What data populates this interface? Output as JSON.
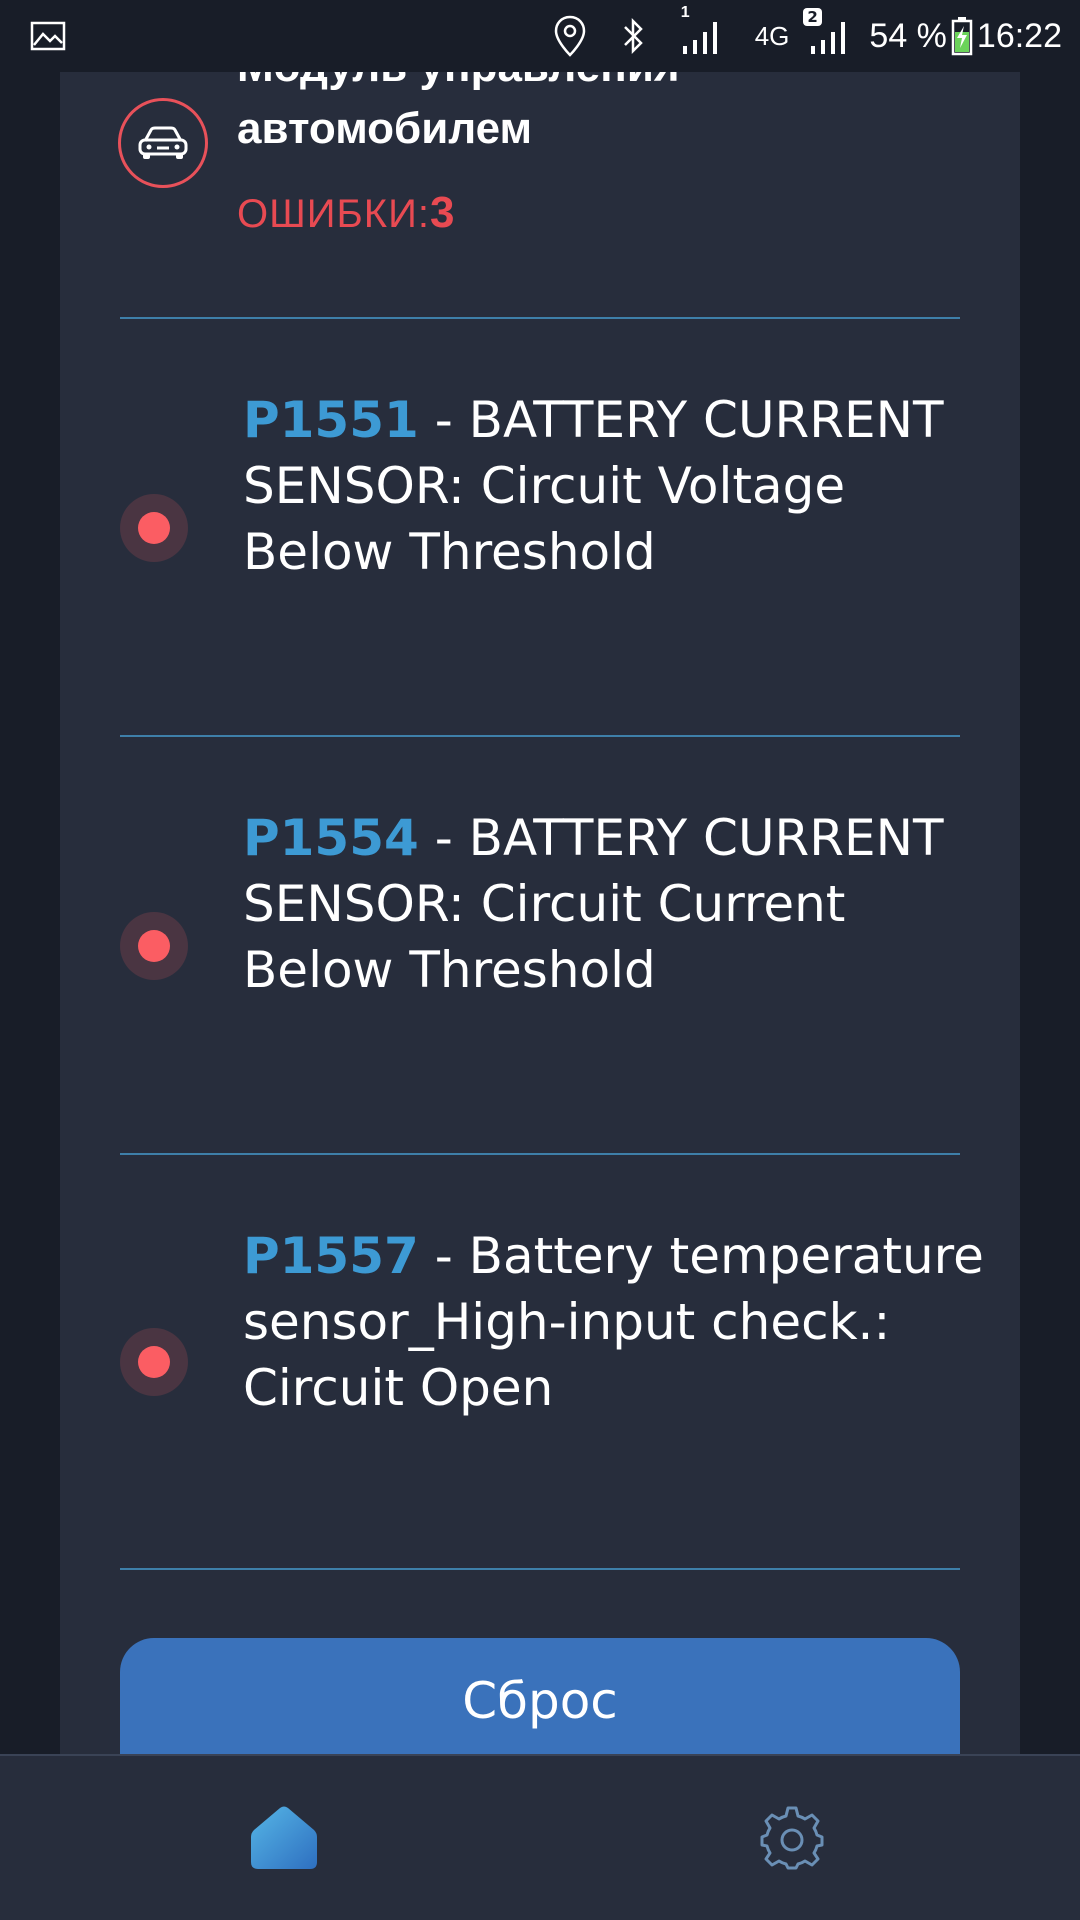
{
  "status_bar": {
    "battery_percent": "54 %",
    "time": "16:22",
    "sim1_label": "1",
    "sim2_label": "2",
    "network": "4G"
  },
  "module": {
    "title": "Модуль управления автомобилем",
    "errors_label": "ОШИБКИ:",
    "errors_count": "3"
  },
  "errors": [
    {
      "code": "P1551",
      "description": " - BATTERY CURRENT SENSOR: Circuit Voltage Below Threshold"
    },
    {
      "code": "P1554",
      "description": " - BATTERY CURRENT SENSOR: Circuit Current Below Threshold"
    },
    {
      "code": "P1557",
      "description": " - Battery temperature sensor_High-input check.: Circuit Open"
    }
  ],
  "reset_button": {
    "label": "Сброс"
  },
  "colors": {
    "background": "#181d28",
    "panel": "#272d3c",
    "accent_blue": "#3d9ad4",
    "error_red": "#e84a52",
    "button_blue": "#3a72bb"
  },
  "icons": {
    "status_left": "image-icon",
    "status_right": [
      "location-icon",
      "bluetooth-icon",
      "signal-icon",
      "network-4g-icon",
      "signal-icon",
      "battery-charging-icon"
    ],
    "module": "car-icon",
    "nav": [
      "home-icon",
      "gear-icon"
    ]
  }
}
